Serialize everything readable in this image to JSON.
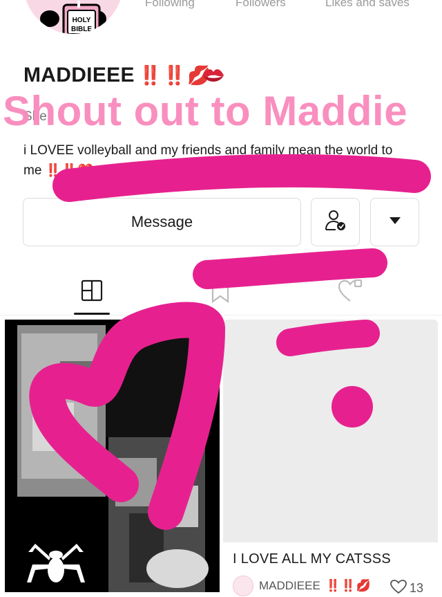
{
  "stats": [
    {
      "label": "Following"
    },
    {
      "label": "Followers"
    },
    {
      "label": "Likes and saves"
    }
  ],
  "avatar": {
    "badge_text": "HOLY BIBLE"
  },
  "profile": {
    "name": "MADDIEEE",
    "name_emoji": "‼️ ‼️ 💋",
    "shout_text": "Shout out to Maddie",
    "bio_partial": "She",
    "bio": "i LOVEE volleyball and my friends and family mean the world to me",
    "bio_emoji": "‼️ ‼️ ❤️"
  },
  "actions": {
    "message_label": "Message",
    "follow_icon": "user-check-icon",
    "more_icon": "caret-down-icon"
  },
  "tabs": [
    {
      "icon": "grid-icon",
      "active": true
    },
    {
      "icon": "bookmark-icon",
      "active": false
    },
    {
      "icon": "heart-icon",
      "active": false
    }
  ],
  "posts": [
    {
      "image": "black-collage-with-spider-logo"
    },
    {
      "title": "I LOVE ALL MY CATSSS",
      "author": "MADDIEEE",
      "author_emoji": "‼️ ‼️ 💋",
      "likes": "13"
    }
  ],
  "colors": {
    "accent_pink": "#f98bbc",
    "scribble_magenta": "#e6218f",
    "bang_red": "#e0263a"
  }
}
